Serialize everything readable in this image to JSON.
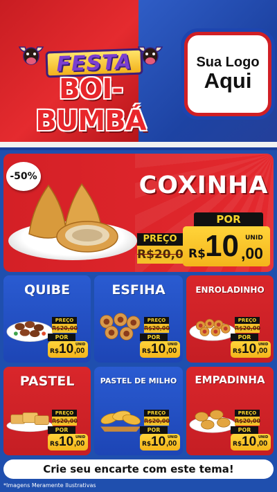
{
  "header": {
    "festa": "FESTA",
    "boi_bumba": "BOI-BUMBÁ",
    "logo_line1": "Sua Logo",
    "logo_line2": "Aqui"
  },
  "featured": {
    "discount": "-50%",
    "name": "COXINHA",
    "preco_label": "PREÇO",
    "old_price": "R$20,00",
    "por_label": "POR",
    "currency": "R$",
    "price_int": "10",
    "price_cents": ",00",
    "unit": "UNID"
  },
  "products": [
    {
      "name": "QUIBE",
      "preco_label": "PREÇO",
      "old_price": "R$20,00",
      "por_label": "POR",
      "currency": "R$",
      "price_int": "10",
      "price_cents": ",00",
      "unit": "UNID"
    },
    {
      "name": "ESFIHA",
      "preco_label": "PREÇO",
      "old_price": "R$20,00",
      "por_label": "POR",
      "currency": "R$",
      "price_int": "10",
      "price_cents": ",00",
      "unit": "UNID"
    },
    {
      "name": "ENROLADINHO",
      "preco_label": "PREÇO",
      "old_price": "R$20,00",
      "por_label": "POR",
      "currency": "R$",
      "price_int": "10",
      "price_cents": ",00",
      "unit": "UNID"
    },
    {
      "name": "PASTEL",
      "preco_label": "PREÇO",
      "old_price": "R$20,00",
      "por_label": "POR",
      "currency": "R$",
      "price_int": "10",
      "price_cents": ",00",
      "unit": "UNID"
    },
    {
      "name": "PASTEL DE MILHO",
      "preco_label": "PREÇO",
      "old_price": "R$20,00",
      "por_label": "POR",
      "currency": "R$",
      "price_int": "10",
      "price_cents": ",00",
      "unit": "UNID"
    },
    {
      "name": "EMPADINHA",
      "preco_label": "PREÇO",
      "old_price": "R$20,00",
      "por_label": "POR",
      "currency": "R$",
      "price_int": "10",
      "price_cents": ",00",
      "unit": "UNID"
    }
  ],
  "footer": {
    "cta": "Crie seu encarte com este tema!",
    "disclaimer": "*Imagens Meramente Ilustrativas"
  },
  "colors": {
    "red": "#e4292e",
    "blue": "#1d45b5",
    "yellow": "#f4c02a",
    "black": "#111111"
  }
}
